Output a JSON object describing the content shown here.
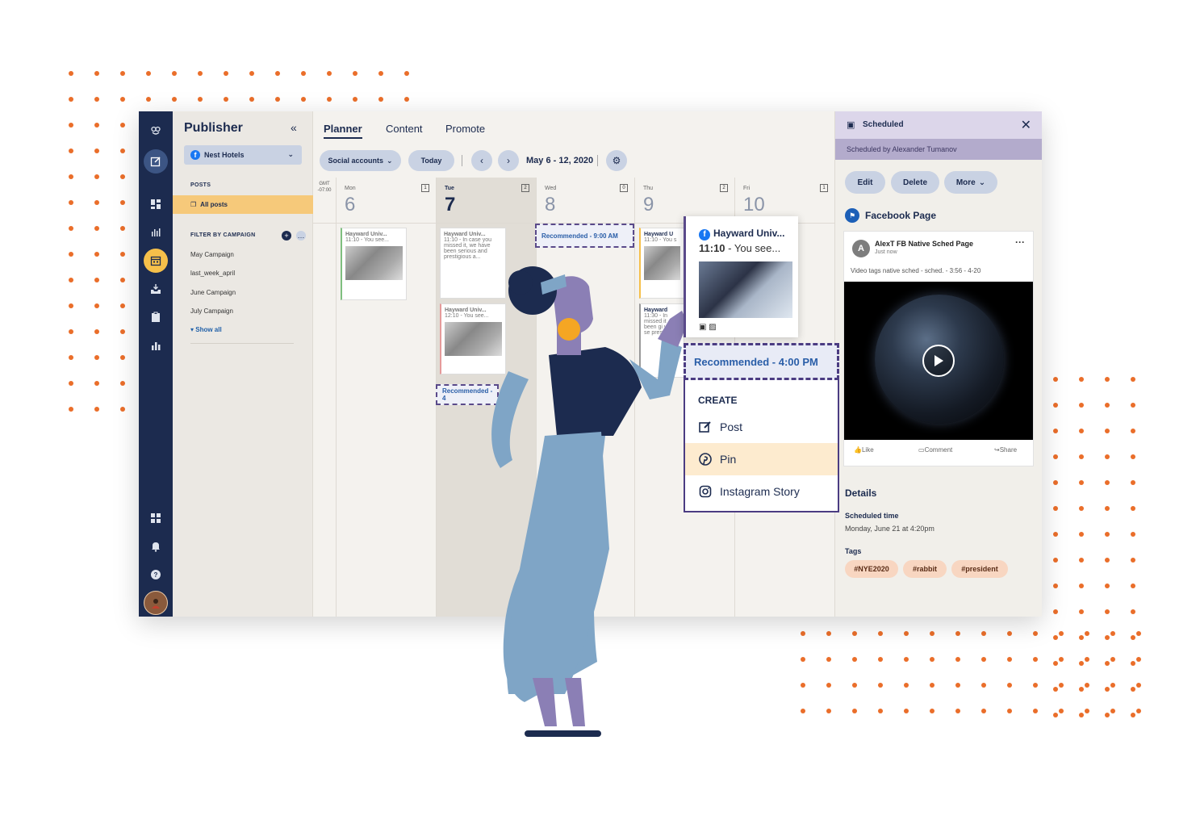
{
  "rail": {
    "icons": [
      "owl-logo-icon",
      "compose-icon",
      "dashboard-icon",
      "analytics-icon",
      "calendar-icon",
      "inbox-icon",
      "clipboard-icon",
      "bar-chart-icon",
      "apps-icon",
      "bell-icon",
      "help-icon",
      "avatar"
    ]
  },
  "sidebar": {
    "title": "Publisher",
    "collapse": "«",
    "account": "Nest Hotels",
    "posts_label": "POSTS",
    "all_posts": "All posts",
    "filter_label": "FILTER BY CAMPAIGN",
    "campaigns": [
      "May Campaign",
      "last_week_april",
      "June Campaign",
      "July Campaign"
    ],
    "show_all": "Show all"
  },
  "main": {
    "tabs": [
      "Planner",
      "Content",
      "Promote"
    ],
    "social_accounts": "Social accounts",
    "today": "Today",
    "prev": "‹",
    "next": "›",
    "date_range": "May 6 - 12, 2020",
    "gmt_line1": "GMT",
    "gmt_line2": "-07:00",
    "days": [
      {
        "name": "Mon",
        "num": "6",
        "count": "1"
      },
      {
        "name": "Tue",
        "num": "7",
        "count": "2"
      },
      {
        "name": "Wed",
        "num": "8",
        "count": "0"
      },
      {
        "name": "Thu",
        "num": "9",
        "count": "2"
      },
      {
        "name": "Fri",
        "num": "10",
        "count": "1"
      }
    ],
    "cards": {
      "mon1": {
        "title": "Hayward Univ...",
        "text": "11:10 - You see..."
      },
      "tue1": {
        "title": "Hayward Univ...",
        "text": "11:10 - In case you missed it, we have been serious and prestigious a..."
      },
      "tue2": {
        "title": "Hayward Univ...",
        "text": "12:10 - You see..."
      },
      "thu1": {
        "title": "Hayward U",
        "text": "11:10 - You s"
      },
      "thu2": {
        "title": "Hayward",
        "text": "11:30 - In missed it been gi very se prest"
      }
    },
    "rec_wed": "Recommended - 9:00 AM",
    "rec_tue": "Recommended - 4"
  },
  "popover": {
    "title": "Hayward Univ...",
    "time": "11:10",
    "text": " - You see...",
    "recommended": "Recommended - 4:00 PM",
    "create_label": "CREATE",
    "items": [
      "Post",
      "Pin",
      "Instagram Story"
    ]
  },
  "panel": {
    "status": "Scheduled",
    "scheduled_by": "Scheduled by Alexander Tumanov",
    "edit": "Edit",
    "delete": "Delete",
    "more": "More",
    "network": "Facebook Page",
    "post": {
      "avatar": "A",
      "author": "AlexT FB Native Sched Page",
      "when": "Just now",
      "caption": "Video tags native sched - sched. - 3:56 - 4-20",
      "like": "Like",
      "comment": "Comment",
      "share": "Share"
    },
    "details_heading": "Details",
    "scheduled_time_label": "Scheduled time",
    "scheduled_time_value": "Monday, June 21 at 4:20pm",
    "tags_label": "Tags",
    "tags": [
      "#NYE2020",
      "#rabbit",
      "#president"
    ]
  },
  "colors": {
    "navy": "#1c2b4f",
    "accent_orange": "#ea6e2a",
    "highlight_yellow": "#f6c97a",
    "purple": "#4b3c82"
  }
}
